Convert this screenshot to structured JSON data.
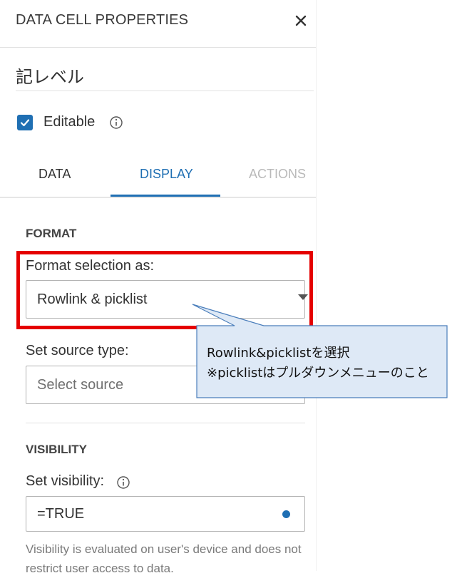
{
  "header": {
    "title": "DATA CELL PROPERTIES"
  },
  "cell": {
    "name": "記レベル"
  },
  "editable": {
    "label": "Editable",
    "checked": true
  },
  "tabs": [
    {
      "label": "DATA",
      "state": "normal"
    },
    {
      "label": "DISPLAY",
      "state": "active"
    },
    {
      "label": "ACTIONS",
      "state": "disabled"
    }
  ],
  "format": {
    "section_title": "FORMAT",
    "selection_label": "Format selection as:",
    "selection_value": "Rowlink & picklist",
    "source_label": "Set source type:",
    "source_placeholder": "Select source"
  },
  "visibility": {
    "section_title": "VISIBILITY",
    "label": "Set visibility:",
    "value": "=TRUE",
    "help": "Visibility is evaluated on user's device and does not restrict user access to data."
  },
  "callout": {
    "line1": "Rowlink&picklistを選択",
    "line2": "※picklistはプルダウンメニューのこと"
  },
  "colors": {
    "accent": "#1f6fb3",
    "highlight_border": "#e50000",
    "callout_fill": "#dee9f6",
    "callout_border": "#4a7ebb"
  },
  "icons": [
    "close-icon",
    "check-icon",
    "info-icon",
    "chevron-down-icon"
  ]
}
